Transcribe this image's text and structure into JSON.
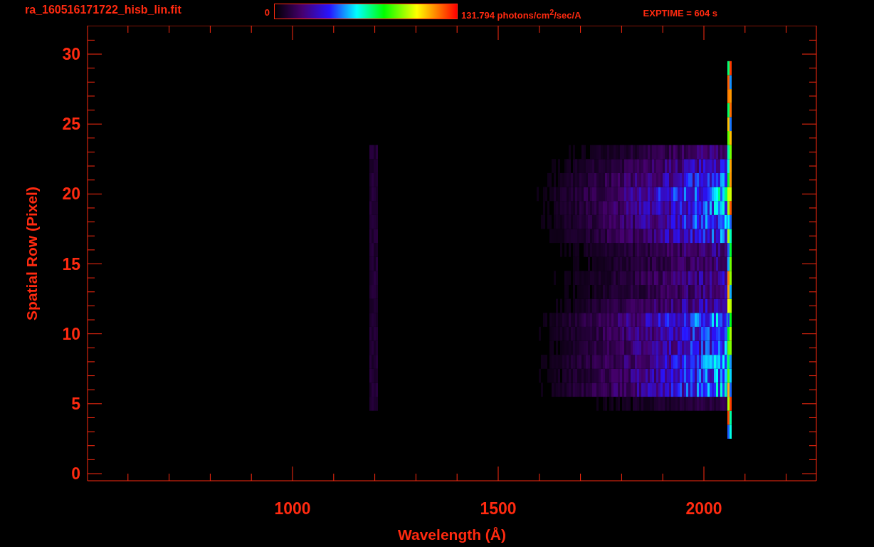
{
  "header": {
    "filename": "ra_160516171722_hisb_lin.fit",
    "colorbar_min": "0",
    "colorbar_max": "131.794 photons/cm$^{2}$/sec/A",
    "exptime": "EXPTIME = 604 s"
  },
  "plot": {
    "xlabel": "Wavelength (Å)",
    "ylabel": "Spatial Row (Pixel)",
    "xtick_labels": [
      "1000",
      "1500",
      "2000"
    ],
    "ytick_labels": [
      "30",
      "25",
      "20",
      "15",
      "10",
      "5",
      "0"
    ]
  }
}
